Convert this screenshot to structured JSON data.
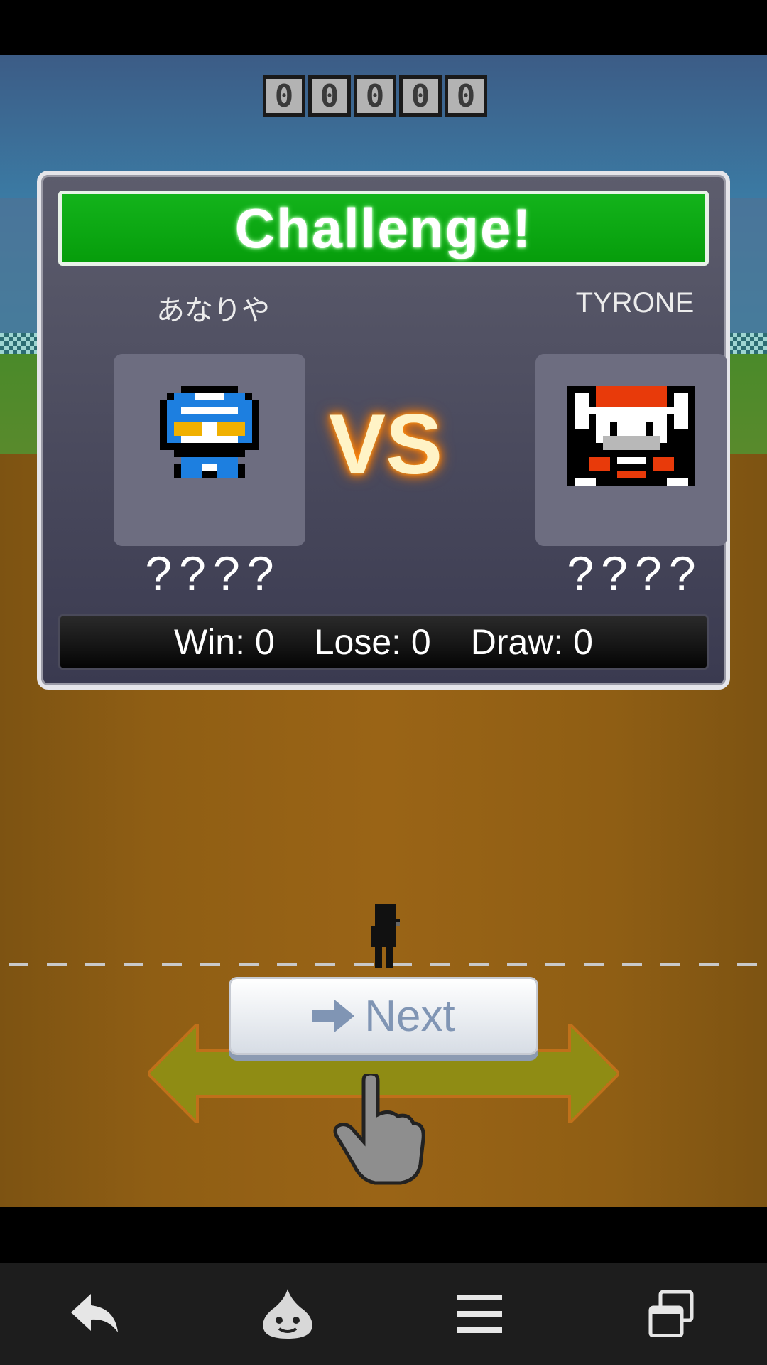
{
  "score": {
    "digits": [
      "0",
      "0",
      "0",
      "0",
      "0"
    ]
  },
  "panel": {
    "title": "Challenge!",
    "player_left": {
      "name": "あなりや",
      "rank": "????"
    },
    "player_right": {
      "name": "TYRONE",
      "rank": "????"
    },
    "vs_label": "VS",
    "record": {
      "win": "Win: 0",
      "lose": "Lose: 0",
      "draw": "Draw: 0"
    }
  },
  "next_button": {
    "label": "Next",
    "icon": "arrow-right-icon"
  },
  "navbar": {
    "icons": [
      "back-icon",
      "slime-icon",
      "menu-icon",
      "recent-apps-icon"
    ]
  },
  "colors": {
    "title_green": "#0fa614",
    "vs_glow": "#ff7a00",
    "button_text": "#8095b4"
  }
}
